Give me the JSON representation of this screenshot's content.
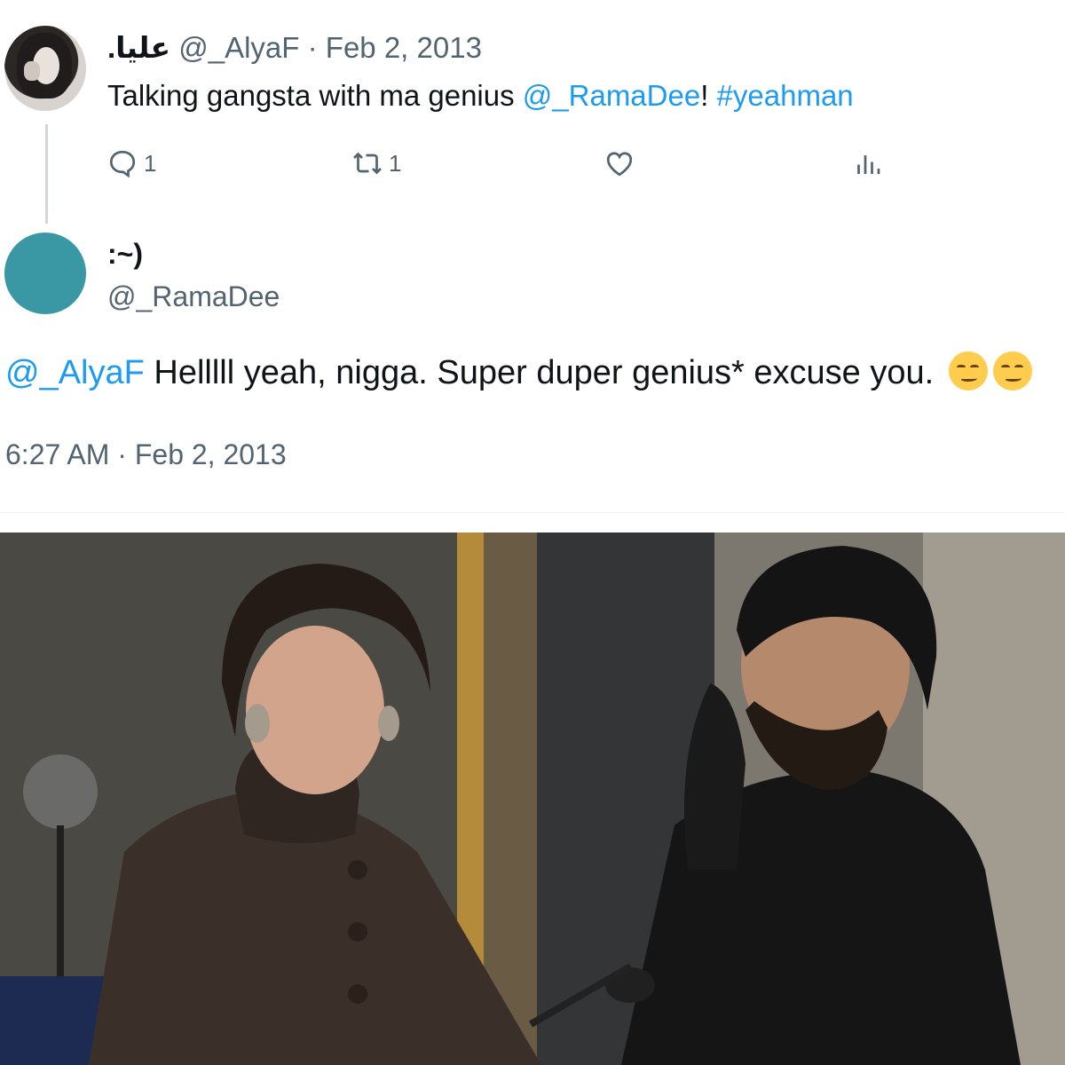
{
  "tweet1": {
    "name": "عليا.",
    "handle": "@_AlyaF",
    "separator": "·",
    "date": "Feb 2, 2013",
    "text_prefix": "Talking gangsta with ma genius ",
    "mention": "@_RamaDee",
    "text_punct": "! ",
    "hashtag": "#yeahman",
    "actions": {
      "reply_icon": "reply-icon",
      "reply_count": "1",
      "retweet_icon": "retweet-icon",
      "retweet_count": "1",
      "like_icon": "heart-icon",
      "views_icon": "analytics-icon"
    }
  },
  "tweet2": {
    "name": ":~)",
    "handle": "@_RamaDee",
    "mention": "@_AlyaF",
    "text": " Helllll yeah, nigga. Super duper genius* excuse you.",
    "emoji": "smirking-face-emoji",
    "timestamp": "6:27 AM",
    "separator": "·",
    "date": "Feb 2, 2013"
  },
  "colors": {
    "link": "#1d9bf0",
    "meta": "#536471",
    "text": "#0f1419",
    "avatar2": "#3a98a5"
  }
}
